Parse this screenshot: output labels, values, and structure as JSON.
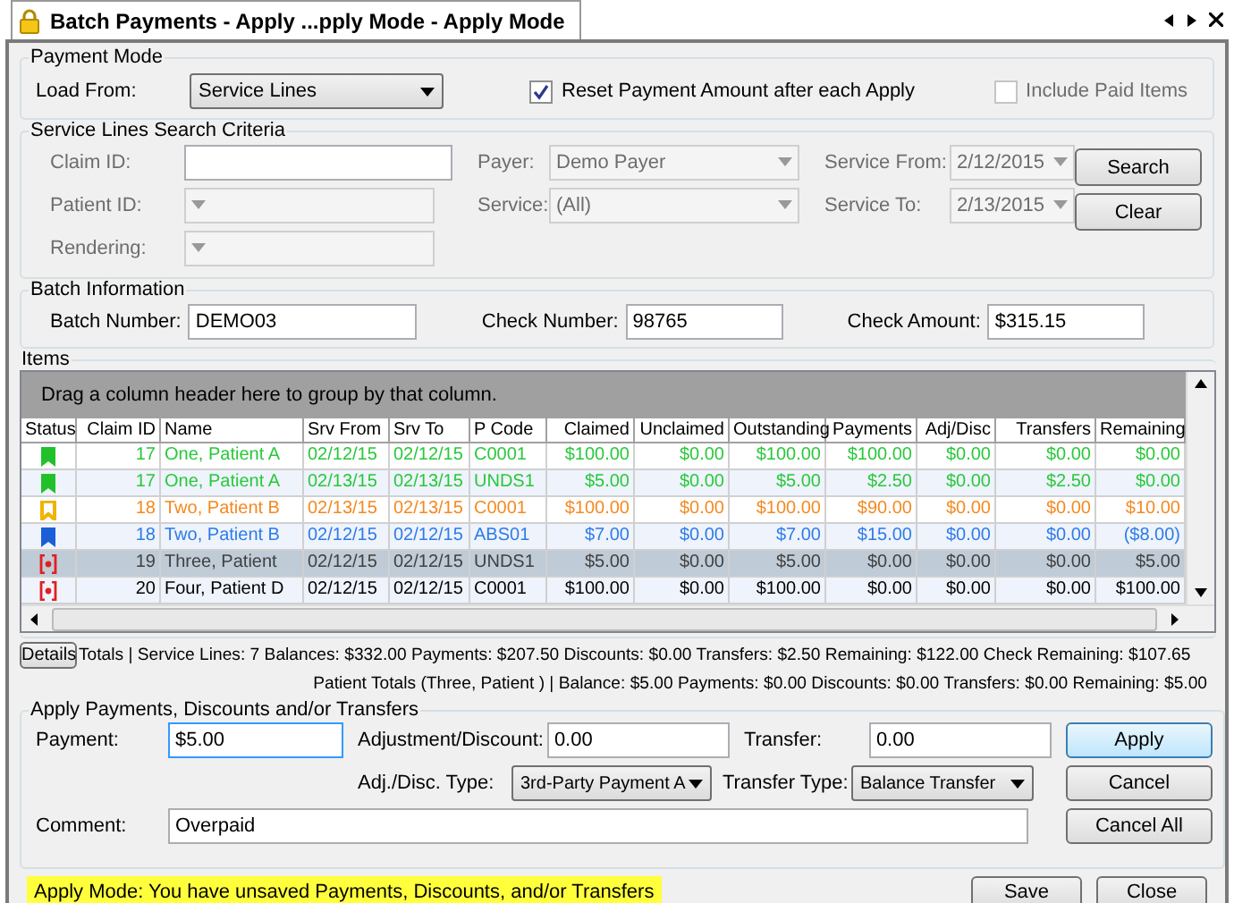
{
  "window": {
    "title": "Batch Payments - Apply ...pply Mode - Apply Mode"
  },
  "payment_mode": {
    "legend": "Payment Mode",
    "load_from": {
      "label": "Load From:",
      "value": "Service Lines"
    },
    "reset_payment": {
      "label": "Reset Payment Amount after each Apply",
      "checked": true
    },
    "include_paid": {
      "label": "Include Paid Items",
      "checked": false,
      "disabled": true
    }
  },
  "search": {
    "legend": "Service Lines Search Criteria",
    "columns": [
      [
        {
          "label": "Claim ID:",
          "kind": "text",
          "disabled": false
        },
        {
          "label": "Patient ID:",
          "kind": "combo",
          "disabled": true
        },
        {
          "label": "Rendering:",
          "kind": "combo",
          "disabled": true
        }
      ],
      [
        {
          "label": "Payer:",
          "kind": "combo",
          "value": "Demo Payer",
          "disabled": true
        },
        {
          "label": "Service:",
          "kind": "combo",
          "value": "(All)",
          "disabled": true
        }
      ],
      [
        {
          "label": "Service From:",
          "kind": "date",
          "value": "2/12/2015",
          "disabled": true
        },
        {
          "label": "Service To:",
          "kind": "date",
          "value": "2/13/2015",
          "disabled": true
        }
      ]
    ],
    "buttons": [
      "Search",
      "Clear"
    ]
  },
  "batch": {
    "legend": "Batch Information",
    "fields": [
      {
        "label": "Batch Number:",
        "value": "DEMO03"
      },
      {
        "label": "Check Number:",
        "value": "98765"
      },
      {
        "label": "Check Amount:",
        "value": "$315.15"
      }
    ]
  },
  "items": {
    "legend": "Items",
    "group_hint": "Drag a column header here to group by that column.",
    "columns": [
      "Status",
      "Claim ID",
      "Name",
      "Srv From",
      "Srv To",
      "P Code",
      "Claimed",
      "Unclaimed",
      "Outstanding",
      "Payments",
      "Adj/Disc",
      "Transfers",
      "Remaining"
    ],
    "rows": [
      {
        "status": {
          "kind": "filled",
          "color": "#22c12a"
        },
        "color": "#28c83a",
        "selected": false,
        "cells": [
          "",
          "17",
          "One, Patient A",
          "02/12/15",
          "02/12/15",
          "C0001",
          "$100.00",
          "$0.00",
          "$100.00",
          "$100.00",
          "$0.00",
          "$0.00",
          "$0.00"
        ]
      },
      {
        "status": {
          "kind": "filled",
          "color": "#22c12a"
        },
        "color": "#28c83a",
        "selected": false,
        "cells": [
          "",
          "17",
          "One, Patient A",
          "02/13/15",
          "02/13/15",
          "UNDS1",
          "$5.00",
          "$0.00",
          "$5.00",
          "$2.50",
          "$0.00",
          "$2.50",
          "$0.00"
        ]
      },
      {
        "status": {
          "kind": "outline",
          "color": "#f0b400"
        },
        "color": "#f5891f",
        "selected": false,
        "cells": [
          "",
          "18",
          "Two, Patient B",
          "02/13/15",
          "02/13/15",
          "C0001",
          "$100.00",
          "$0.00",
          "$100.00",
          "$90.00",
          "$0.00",
          "$0.00",
          "$10.00"
        ]
      },
      {
        "status": {
          "kind": "filled",
          "color": "#1a5fd6"
        },
        "color": "#2e7be8",
        "selected": false,
        "cells": [
          "",
          "18",
          "Two, Patient B",
          "02/12/15",
          "02/12/15",
          "ABS01",
          "$7.00",
          "$0.00",
          "$7.00",
          "$15.00",
          "$0.00",
          "$0.00",
          "($8.00)"
        ]
      },
      {
        "status": {
          "kind": "bracket",
          "color": "#e02020"
        },
        "color": "#404040",
        "selected": true,
        "cells": [
          "",
          "19",
          "Three, Patient",
          "02/12/15",
          "02/12/15",
          "UNDS1",
          "$5.00",
          "$0.00",
          "$5.00",
          "$0.00",
          "$0.00",
          "$0.00",
          "$5.00"
        ]
      },
      {
        "status": {
          "kind": "bracket",
          "color": "#e02020"
        },
        "color": "#000000",
        "selected": false,
        "cells": [
          "",
          "20",
          "Four, Patient D",
          "02/12/15",
          "02/12/15",
          "C0001",
          "$100.00",
          "$0.00",
          "$100.00",
          "$0.00",
          "$0.00",
          "$0.00",
          "$100.00"
        ]
      }
    ]
  },
  "totals": {
    "details_button": "Details",
    "line_1": "Totals | Service Lines: 7 Balances: $332.00 Payments: $207.50 Discounts: $0.00 Transfers: $2.50 Remaining: $122.00 Check Remaining: $107.65",
    "line_2": "Patient Totals (Three, Patient ) |  Balance: $5.00 Payments: $0.00 Discounts: $0.00 Transfers: $0.00 Remaining: $5.00"
  },
  "apply": {
    "legend": "Apply Payments, Discounts and/or Transfers",
    "payment": {
      "label": "Payment:",
      "value": "$5.00"
    },
    "adjustment": {
      "label": "Adjustment/Discount:",
      "value": "0.00"
    },
    "transfer": {
      "label": "Transfer:",
      "value": "0.00"
    },
    "adj_type": {
      "label": "Adj./Disc. Type:",
      "value": "3rd-Party Payment A"
    },
    "transfer_type": {
      "label": "Transfer Type:",
      "value": "Balance Transfer"
    },
    "comment": {
      "label": "Comment:",
      "value": "Overpaid"
    },
    "buttons": [
      {
        "label": "Apply",
        "default": true
      },
      {
        "label": "Cancel",
        "default": false
      },
      {
        "label": "Cancel All",
        "default": false
      }
    ]
  },
  "footer": {
    "message": "Apply Mode: You have unsaved Payments, Discounts, and/or Transfers",
    "buttons": [
      "Save",
      "Close"
    ]
  }
}
